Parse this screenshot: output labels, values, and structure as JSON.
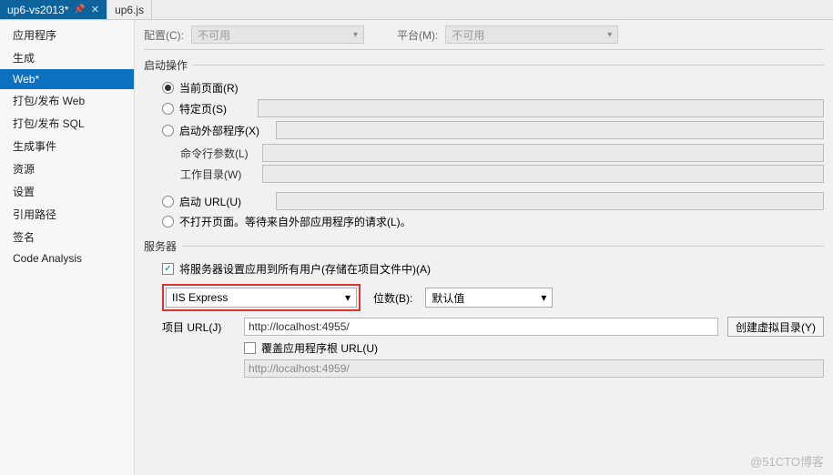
{
  "tabs": [
    {
      "label": "up6-vs2013*",
      "active": true,
      "pinned": true
    },
    {
      "label": "up6.js",
      "active": false
    }
  ],
  "sidebar": {
    "items": [
      "应用程序",
      "生成",
      "Web*",
      "打包/发布 Web",
      "打包/发布 SQL",
      "生成事件",
      "资源",
      "设置",
      "引用路径",
      "签名",
      "Code Analysis"
    ],
    "activeIndex": 2
  },
  "top": {
    "config_label": "配置(C):",
    "config_value": "不可用",
    "platform_label": "平台(M):",
    "platform_value": "不可用"
  },
  "start": {
    "section": "启动操作",
    "current_page": "当前页面(R)",
    "specific_page": "特定页(S)",
    "external_prog": "启动外部程序(X)",
    "cmd_args": "命令行参数(L)",
    "workdir": "工作目录(W)",
    "start_url": "启动 URL(U)",
    "no_open": "不打开页面。等待来自外部应用程序的请求(L)。"
  },
  "server": {
    "section": "服务器",
    "apply_all": "将服务器设置应用到所有用户(存储在项目文件中)(A)",
    "server_value": "IIS Express",
    "bits_label": "位数(B):",
    "bits_value": "默认值",
    "project_url_label": "项目 URL(J)",
    "project_url_value": "http://localhost:4955/",
    "create_vdir": "创建虚拟目录(Y)",
    "override_root": "覆盖应用程序根 URL(U)",
    "override_root_value": "http://localhost:4959/"
  },
  "watermark": "@51CTO博客"
}
